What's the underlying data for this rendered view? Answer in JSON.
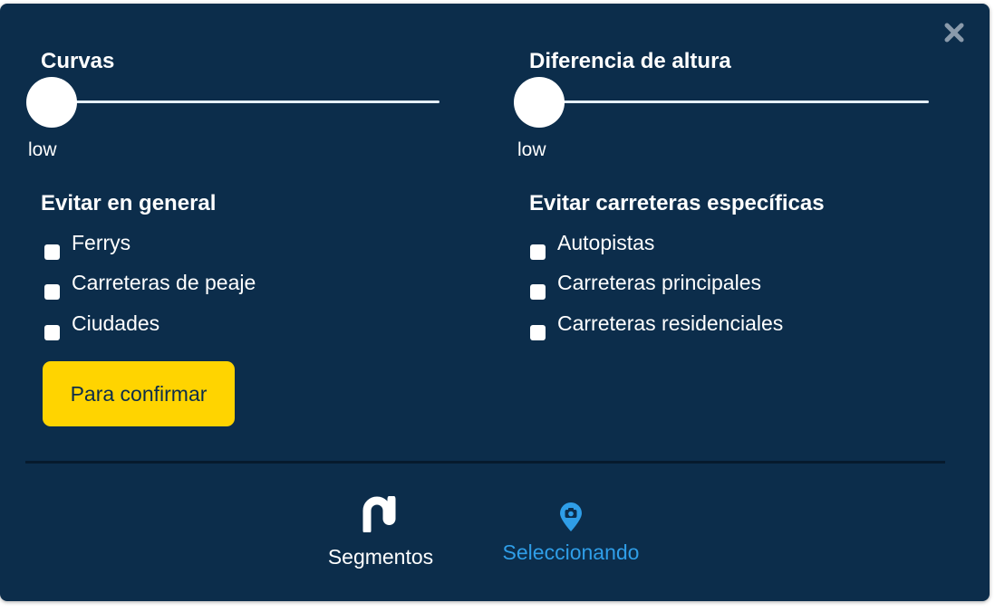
{
  "colors": {
    "panel_bg": "#0c2d4b",
    "accent_yellow": "#ffd400",
    "active_tab_blue": "#2f9ee8",
    "text_white": "#ffffff"
  },
  "close": {
    "icon": "close-x-icon"
  },
  "sliders": [
    {
      "title": "Curvas",
      "value_label": "low",
      "level": 0
    },
    {
      "title": "Diferencia de altura",
      "value_label": "low",
      "level": 0
    }
  ],
  "avoid_general": {
    "title": "Evitar en general",
    "options": [
      {
        "label": "Ferrys",
        "checked": false
      },
      {
        "label": "Carreteras de peaje",
        "checked": false
      },
      {
        "label": "Ciudades",
        "checked": false
      }
    ]
  },
  "avoid_specific": {
    "title": "Evitar carreteras específicas",
    "options": [
      {
        "label": "Autopistas",
        "checked": false
      },
      {
        "label": "Carreteras principales",
        "checked": false
      },
      {
        "label": "Carreteras residenciales",
        "checked": false
      }
    ]
  },
  "confirm_button": {
    "label": "Para confirmar"
  },
  "tabs": [
    {
      "label": "Segmentos",
      "icon": "segments-road-icon",
      "active": false
    },
    {
      "label": "Seleccionando",
      "icon": "map-pin-camera-icon",
      "active": true
    }
  ]
}
